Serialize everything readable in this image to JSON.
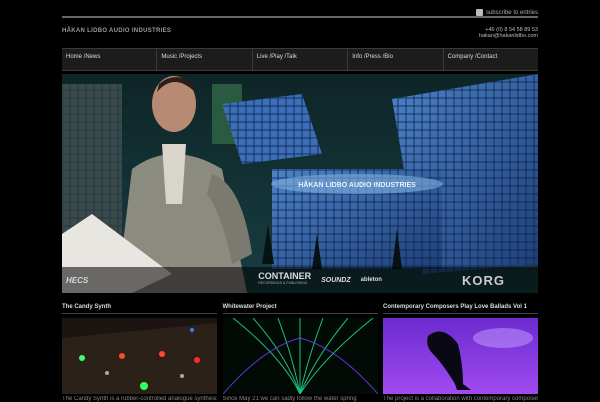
{
  "header": {
    "subscribe_label": "subscribe to entries",
    "site_title": "HÅKAN LIDBO AUDIO INDUSTRIES",
    "phone": "+46 (0) 8 54 58 89 53",
    "email": "hakan@hakanlidbo.com"
  },
  "nav": {
    "items": [
      {
        "label": "Home /News"
      },
      {
        "label": "Music /Projects"
      },
      {
        "label": "Live /Play /Talk"
      },
      {
        "label": "Info /Press /Bio"
      },
      {
        "label": "Company /Contact"
      }
    ]
  },
  "hero": {
    "building_sign": "HÅKAN LIDBO AUDIO INDUSTRIES",
    "logos": [
      "HECS",
      "CONTAINER",
      "SOUNDZ",
      "ableton",
      "KORG"
    ],
    "container_sub": "RECORDINGS & PUBLISHING",
    "colors": {
      "sky": "#0f2a2c",
      "glass": "#3b6fb0",
      "skin": "#c49a86"
    }
  },
  "cards": [
    {
      "title": "The Candy Synth",
      "text": "The Candy Synth is a rubber-controlled analogue synthesizer"
    },
    {
      "title": "Whitewater Project",
      "text": "Since May 21 we can sadly follow the water spring"
    },
    {
      "title": "Contemporary Composers Play Love Ballads Vol 1",
      "text": "The project is a collaboration with contemporary composers"
    }
  ]
}
